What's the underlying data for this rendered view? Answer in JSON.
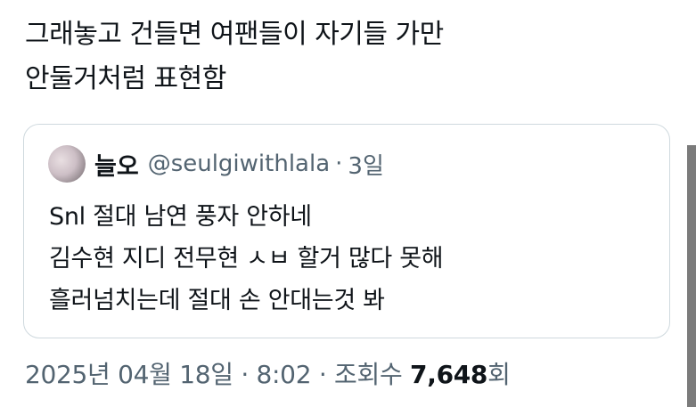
{
  "tweet": {
    "lines": [
      "그래놓고 건들면 여팬들이 자기들 가만",
      "안둘거처럼 표현함"
    ]
  },
  "quote": {
    "name": "늘오",
    "handle": "@seulgiwithlala",
    "separator": "·",
    "time": "3일",
    "lines": [
      "Snl 절대 남연 풍자 안하네",
      "김수현 지디 전무현 ㅅㅂ 할거 많다 못해",
      "흘러넘치는데 절대 손 안대는것 봐"
    ]
  },
  "meta": {
    "date": "2025년 04월 18일",
    "separator": "·",
    "time": "8:02",
    "views_label": "조회수",
    "views_count": "7,648",
    "views_suffix": "회"
  }
}
